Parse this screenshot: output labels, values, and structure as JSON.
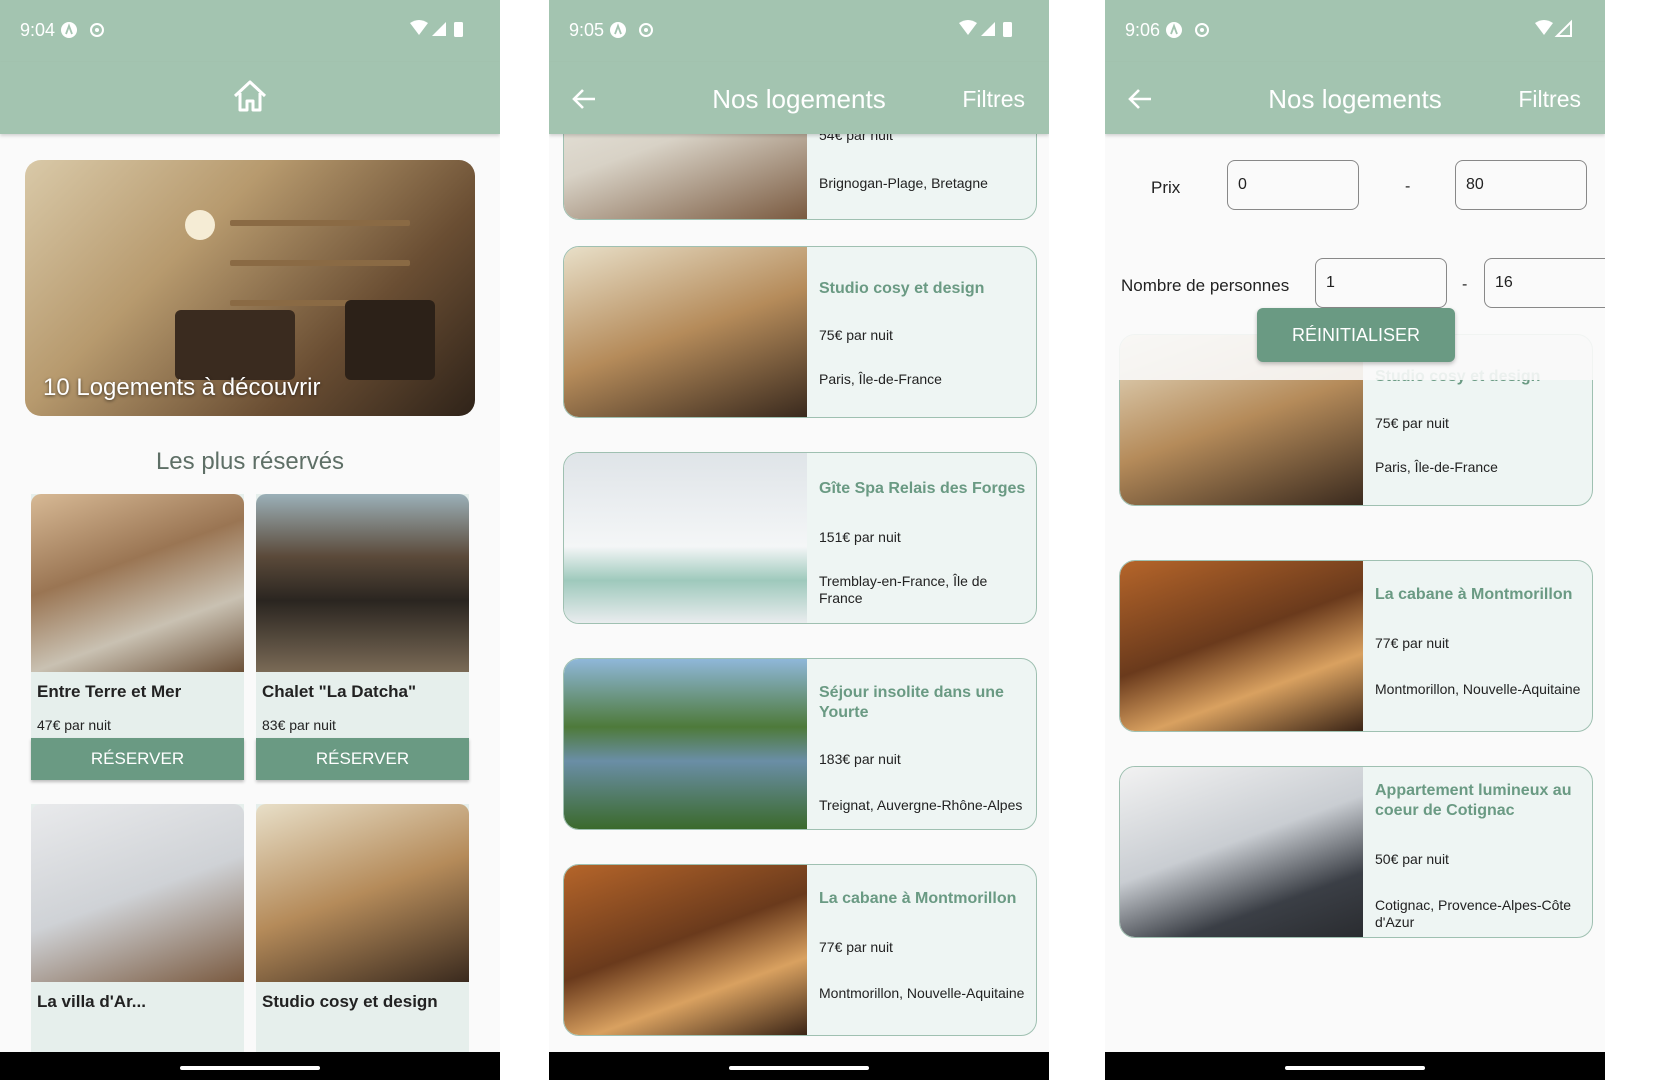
{
  "colors": {
    "primary": "#a3c4b0",
    "accent": "#6a9a83",
    "card_bg": "#eef5f3",
    "text": "#222222"
  },
  "screens": [
    {
      "status": {
        "time": "9:04"
      },
      "home": {
        "hero_caption": "10 Logements à découvrir",
        "section_title": "Les plus réservés",
        "cards": [
          {
            "name": "Entre Terre et Mer",
            "price": "47€ par nuit",
            "button": "RÉSERVER"
          },
          {
            "name": "Chalet \"La Datcha\"",
            "price": "83€ par nuit",
            "button": "RÉSERVER"
          }
        ],
        "partial_cards": [
          {
            "name": "La villa d'Ar..."
          },
          {
            "name": "Studio cosy et design"
          }
        ]
      }
    },
    {
      "status": {
        "time": "9:05"
      },
      "title": "Nos logements",
      "filters_label": "Filtres",
      "listings": [
        {
          "name": "",
          "price": "54€ par nuit",
          "location": "Brignogan-Plage, Bretagne"
        },
        {
          "name": "Studio cosy et design",
          "price": "75€ par nuit",
          "location": "Paris, Île-de-France"
        },
        {
          "name": "Gîte Spa Relais des Forges",
          "price": "151€ par nuit",
          "location": "Tremblay-en-France, Île de France"
        },
        {
          "name": "Séjour insolite dans une Yourte",
          "price": "183€ par nuit",
          "location": "Treignat, Auvergne-Rhône-Alpes"
        },
        {
          "name": "La cabane à Montmorillon",
          "price": "77€ par nuit",
          "location": "Montmorillon, Nouvelle-Aquitaine"
        }
      ]
    },
    {
      "status": {
        "time": "9:06"
      },
      "title": "Nos logements",
      "filters_label": "Filtres",
      "filters": {
        "price_label": "Prix",
        "price_min": "0",
        "price_max": "80",
        "persons_label": "Nombre de personnes",
        "persons_min": "1",
        "persons_max": "16",
        "separator": "-",
        "reset_button": "RÉINITIALISER"
      },
      "listings": [
        {
          "name": "Studio cosy et design",
          "price": "75€ par nuit",
          "location": "Paris, Île-de-France"
        },
        {
          "name": "La cabane à Montmorillon",
          "price": "77€ par nuit",
          "location": "Montmorillon, Nouvelle-Aquitaine"
        },
        {
          "name": "Appartement lumineux au coeur de Cotignac",
          "price": "50€ par nuit",
          "location": "Cotignac, Provence-Alpes-Côte d'Azur"
        }
      ]
    }
  ]
}
